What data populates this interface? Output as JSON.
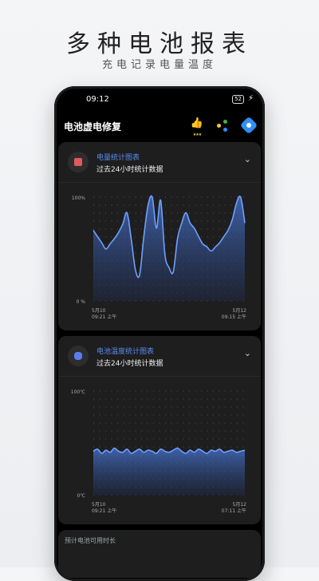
{
  "promo": {
    "title": "多种电池报表",
    "subtitle": "充电记录电量温度"
  },
  "status_bar": {
    "time": "09:12",
    "battery": "52"
  },
  "app_bar": {
    "title": "电池虚电修复",
    "icons": [
      "thumbs-up-icon",
      "share-icon",
      "settings-icon"
    ]
  },
  "cards": [
    {
      "title": "电量统计图表",
      "subtitle": "过去24小时统计数据",
      "icon": "battery-icon",
      "icon_color": "#e05a5a"
    },
    {
      "title": "电池温度统计图表",
      "subtitle": "过去24小时统计数据",
      "icon": "thermometer-icon",
      "icon_color": "#5a7cf0"
    },
    {
      "title": "预计电池可用时长"
    }
  ],
  "colors": {
    "accent": "#5a8cf0",
    "line": "#6fa0ff",
    "card": "#1e1e1e",
    "background": "#000000"
  },
  "chart_data": [
    {
      "type": "area",
      "title": "电量统计图表",
      "ylabel": "",
      "y_ticks": [
        "100%",
        "0 %"
      ],
      "ylim": [
        0,
        100
      ],
      "x_labels": [
        [
          "5月10",
          "09:21 上午"
        ],
        [
          "5月12",
          "09:15 上午"
        ]
      ],
      "series": [
        {
          "values": [
            68,
            62,
            56,
            50,
            55,
            60,
            66,
            74,
            85,
            60,
            30,
            25,
            62,
            92,
            100,
            70,
            97,
            45,
            32,
            28,
            60,
            75,
            85,
            75,
            70,
            62,
            55,
            52,
            48,
            52,
            56,
            62,
            68,
            78,
            94,
            100,
            75
          ]
        }
      ]
    },
    {
      "type": "area",
      "title": "电池温度统计图表",
      "ylabel": "",
      "y_ticks": [
        "100℃",
        "0℃"
      ],
      "ylim": [
        0,
        100
      ],
      "x_labels": [
        [
          "5月10",
          "09:21 上午"
        ],
        [
          "5月12",
          "07:11 上午"
        ]
      ],
      "series": [
        {
          "values": [
            42,
            44,
            40,
            43,
            41,
            45,
            42,
            41,
            44,
            40,
            42,
            44,
            41,
            43,
            42,
            40,
            44,
            42,
            41,
            43,
            45,
            42,
            40,
            43,
            41,
            44,
            42,
            40,
            43,
            42,
            44,
            41,
            42,
            43,
            41,
            42,
            43
          ]
        }
      ]
    }
  ]
}
